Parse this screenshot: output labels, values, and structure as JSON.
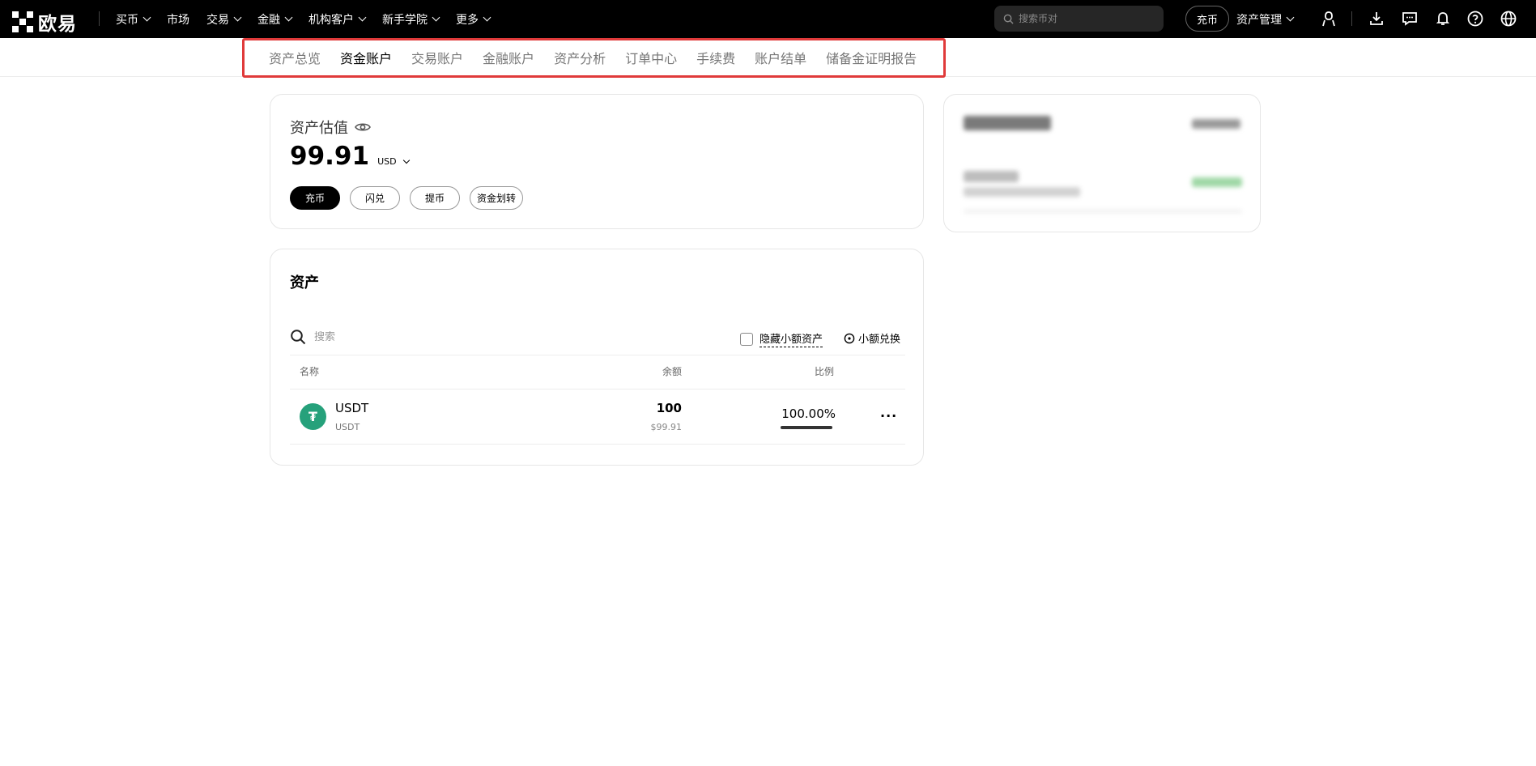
{
  "topbar": {
    "logo_text": "欧易",
    "nav": [
      {
        "label": "买币",
        "dropdown": true
      },
      {
        "label": "市场",
        "dropdown": false
      },
      {
        "label": "交易",
        "dropdown": true
      },
      {
        "label": "金融",
        "dropdown": true
      },
      {
        "label": "机构客户",
        "dropdown": true
      },
      {
        "label": "新手学院",
        "dropdown": true
      },
      {
        "label": "更多",
        "dropdown": true
      }
    ],
    "search_placeholder": "搜索币对",
    "deposit_label": "充币",
    "asset_management_label": "资产管理",
    "icons": [
      "user-icon",
      "download-icon",
      "message-icon",
      "bell-icon",
      "help-icon",
      "globe-icon"
    ]
  },
  "subnav": {
    "tabs": [
      "资产总览",
      "资金账户",
      "交易账户",
      "金融账户",
      "资产分析",
      "订单中心",
      "手续费",
      "账户结单",
      "储备金证明报告"
    ],
    "active_index": 1
  },
  "valuation": {
    "label": "资产估值",
    "amount": "99.91",
    "currency": "USD",
    "buttons": [
      "充币",
      "闪兑",
      "提币",
      "资金划转"
    ]
  },
  "assets": {
    "title": "资产",
    "search_placeholder": "搜索",
    "hide_small_label": "隐藏小额资产",
    "small_convert_label": "小额兑换",
    "columns": [
      "名称",
      "余额",
      "比例"
    ],
    "rows": [
      {
        "symbol": "USDT",
        "name": "USDT",
        "balance": "100",
        "balance_usd": "$99.91",
        "ratio": "100.00%",
        "ratio_value": 1.0
      }
    ]
  },
  "colors": {
    "topbar_bg": "#000000",
    "highlight_border": "#e03a3a",
    "usdt_green": "#26a17b"
  }
}
